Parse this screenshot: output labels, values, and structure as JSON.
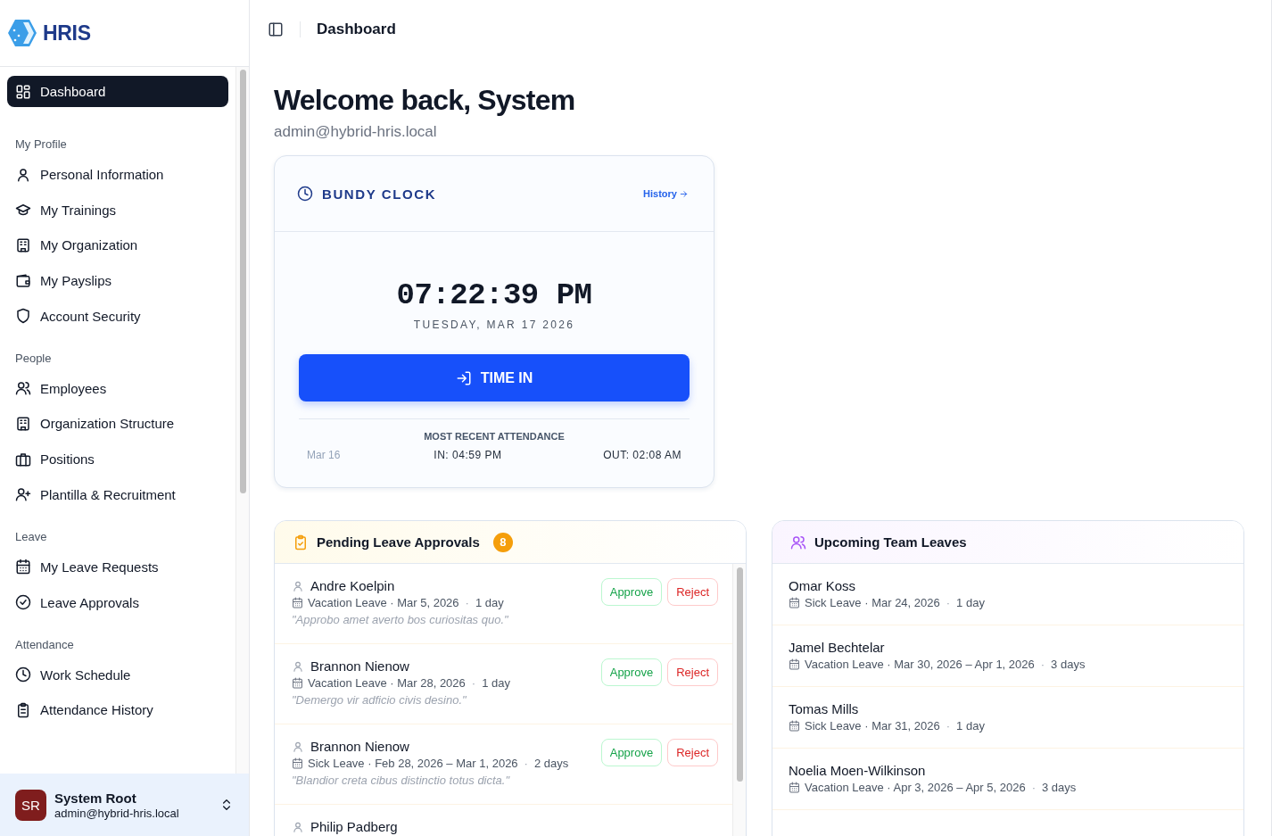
{
  "brand": {
    "name": "HRIS"
  },
  "sidebar": {
    "sections": [
      {
        "items": [
          {
            "label": "Dashboard",
            "selected": true
          }
        ]
      },
      {
        "heading": "My Profile",
        "items": [
          {
            "label": "Personal Information",
            "selected": false
          },
          {
            "label": "My Trainings",
            "selected": false
          },
          {
            "label": "My Organization",
            "selected": false
          },
          {
            "label": "My Payslips",
            "selected": false
          },
          {
            "label": "Account Security",
            "selected": false
          }
        ]
      },
      {
        "heading": "People",
        "items": [
          {
            "label": "Employees",
            "selected": false
          },
          {
            "label": "Organization Structure",
            "selected": false
          },
          {
            "label": "Positions",
            "selected": false
          },
          {
            "label": "Plantilla & Recruitment",
            "selected": false
          }
        ]
      },
      {
        "heading": "Leave",
        "items": [
          {
            "label": "My Leave Requests",
            "selected": false
          },
          {
            "label": "Leave Approvals",
            "selected": false
          }
        ]
      },
      {
        "heading": "Attendance",
        "items": [
          {
            "label": "Work Schedule",
            "selected": false
          },
          {
            "label": "Attendance History",
            "selected": false
          }
        ]
      }
    ]
  },
  "user": {
    "initials": "SR",
    "name": "System Root",
    "email": "admin@hybrid-hris.local"
  },
  "header": {
    "title": "Dashboard"
  },
  "welcome": {
    "title": "Welcome back, System",
    "email": "admin@hybrid-hris.local"
  },
  "bundy_clock": {
    "title": "BUNDY CLOCK",
    "history_link": "History",
    "time": "07:22:39 PM",
    "date": "TUESDAY, MAR 17 2026",
    "button": "TIME IN",
    "recent_label": "MOST RECENT ATTENDANCE",
    "recent_date": "Mar 16",
    "recent_in": "IN: 04:59 PM",
    "recent_out": "OUT: 02:08 AM"
  },
  "pending_approvals": {
    "title": "Pending Leave Approvals",
    "count": "8",
    "requests": [
      {
        "name": "Andre Koelpin",
        "detail": "Vacation Leave · Mar 5, 2026",
        "separator": "·",
        "duration": "1 day",
        "reason": "\"Approbo amet averto bos curiositas quo.\"",
        "approve": "Approve",
        "reject": "Reject"
      },
      {
        "name": "Brannon Nienow",
        "detail": "Vacation Leave · Mar 28, 2026",
        "separator": "·",
        "duration": "1 day",
        "reason": "\"Demergo vir adficio civis desino.\"",
        "approve": "Approve",
        "reject": "Reject"
      },
      {
        "name": "Brannon Nienow",
        "detail": "Sick Leave · Feb 28, 2026 – Mar 1, 2026",
        "separator": "·",
        "duration": "2 days",
        "reason": "\"Blandior creta cibus distinctio totus dicta.\"",
        "approve": "Approve",
        "reject": "Reject"
      },
      {
        "name": "Philip Padberg"
      }
    ]
  },
  "upcoming_leaves": {
    "title": "Upcoming Team Leaves",
    "leaves": [
      {
        "name": "Omar Koss",
        "detail": "Sick Leave · Mar 24, 2026",
        "separator": "·",
        "duration": "1 day"
      },
      {
        "name": "Jamel Bechtelar",
        "detail": "Vacation Leave · Mar 30, 2026 – Apr 1, 2026",
        "separator": "·",
        "duration": "3 days"
      },
      {
        "name": "Tomas Mills",
        "detail": "Sick Leave · Mar 31, 2026",
        "separator": "·",
        "duration": "1 day"
      },
      {
        "name": "Noelia Moen-Wilkinson",
        "detail": "Vacation Leave · Apr 3, 2026 – Apr 5, 2026",
        "separator": "·",
        "duration": "3 days"
      }
    ]
  }
}
